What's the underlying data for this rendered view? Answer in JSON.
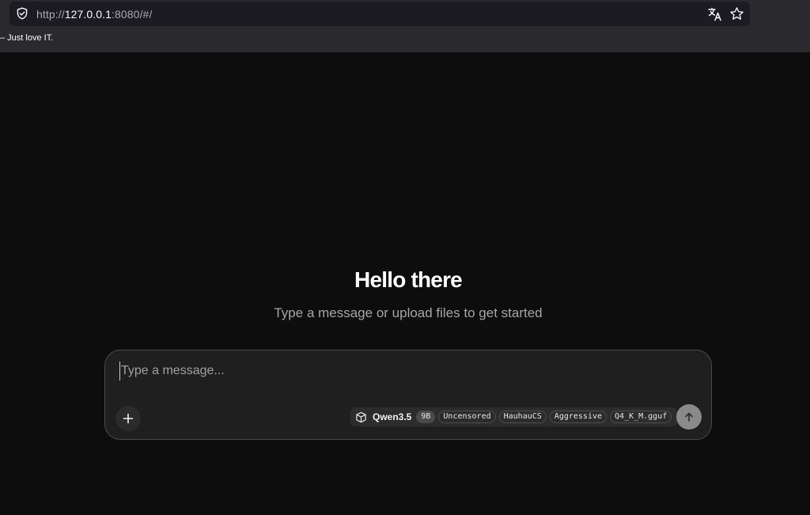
{
  "browser": {
    "url_scheme": "http://",
    "url_host": "127.0.0.1",
    "url_rest": ":8080/#/",
    "bookmark_text": "– Just love IT.",
    "icons": [
      "shield-icon",
      "translate-icon",
      "star-icon"
    ]
  },
  "main": {
    "greeting": "Hello there",
    "subtitle": "Type a message or upload files to get started"
  },
  "composer": {
    "placeholder": "Type a message...",
    "value": "",
    "model": {
      "name": "Qwen3.5",
      "tags": [
        "9B",
        "Uncensored",
        "HauhauCS",
        "Aggressive",
        "Q4_K_M.gguf"
      ]
    },
    "icons": [
      "plus-icon",
      "box-icon",
      "arrow-up-icon"
    ]
  },
  "colors": {
    "background": "#0d0d0d",
    "composer_bg": "#1f1f1f",
    "composer_border": "#4a4a4a",
    "send_button": "#8a8a8a"
  }
}
